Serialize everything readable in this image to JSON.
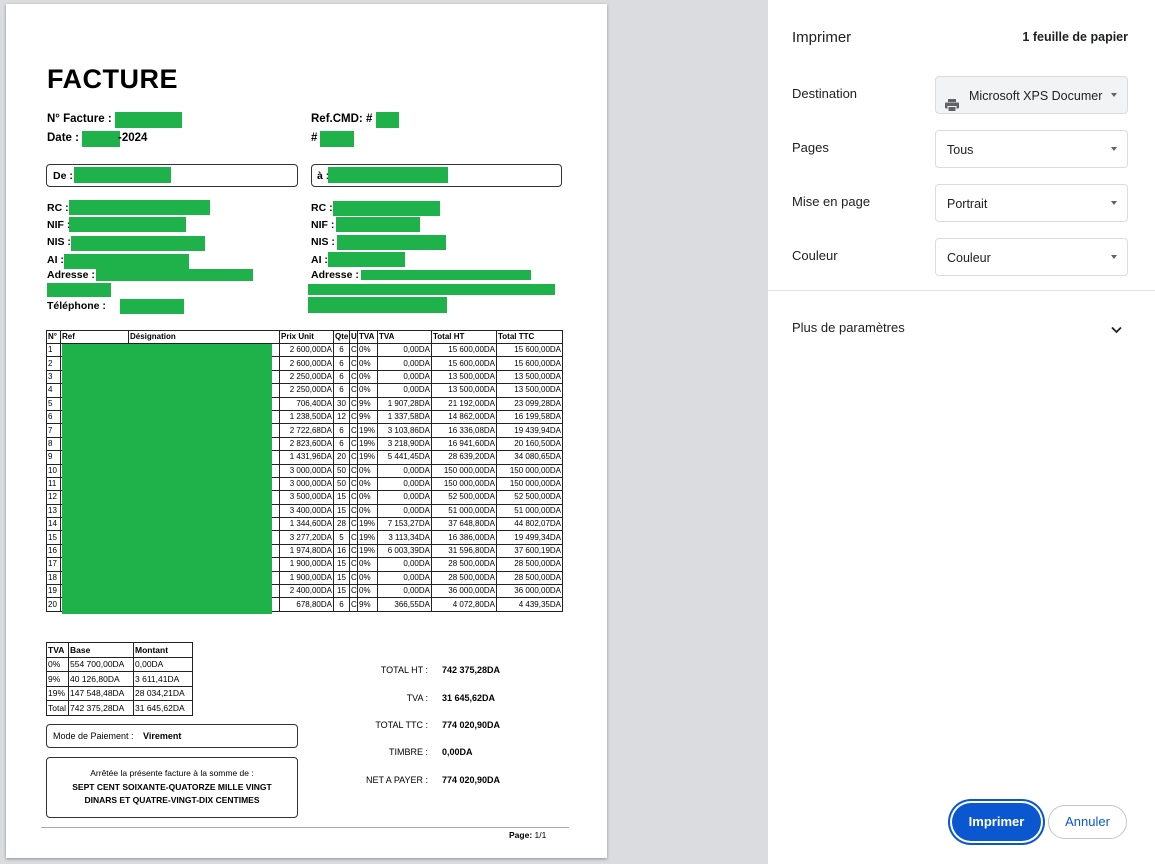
{
  "invoice": {
    "title": "FACTURE",
    "num_label": "N° Facture :",
    "date_label": "Date :",
    "date_year": "-2024",
    "refcmd_label": "Ref.CMD: #",
    "hash": "#",
    "from_label": "De :",
    "to_label": "à :",
    "rc": "RC :",
    "nif": "NIF :",
    "nis": "NIS :",
    "ai": "AI :",
    "adresse": "Adresse :",
    "telephone": "Téléphone :",
    "columns": [
      "N°",
      "Ref",
      "Désignation",
      "Prix Unit",
      "Qte",
      "U",
      "TVA",
      "TVA",
      "Total HT",
      "Total TTC"
    ],
    "rows": [
      [
        "1",
        "2 600,00DA",
        "6",
        "C",
        "0%",
        "0,00DA",
        "15 600,00DA",
        "15 600,00DA"
      ],
      [
        "2",
        "2 600,00DA",
        "6",
        "C",
        "0%",
        "0,00DA",
        "15 600,00DA",
        "15 600,00DA"
      ],
      [
        "3",
        "2 250,00DA",
        "6",
        "C",
        "0%",
        "0,00DA",
        "13 500,00DA",
        "13 500,00DA"
      ],
      [
        "4",
        "2 250,00DA",
        "6",
        "C",
        "0%",
        "0,00DA",
        "13 500,00DA",
        "13 500,00DA"
      ],
      [
        "5",
        "706,40DA",
        "30",
        "C",
        "9%",
        "1 907,28DA",
        "21 192,00DA",
        "23 099,28DA"
      ],
      [
        "6",
        "1 238,50DA",
        "12",
        "C",
        "9%",
        "1 337,58DA",
        "14 862,00DA",
        "16 199,58DA"
      ],
      [
        "7",
        "2 722,68DA",
        "6",
        "C",
        "19%",
        "3 103,86DA",
        "16 336,08DA",
        "19 439,94DA"
      ],
      [
        "8",
        "2 823,60DA",
        "6",
        "C",
        "19%",
        "3 218,90DA",
        "16 941,60DA",
        "20 160,50DA"
      ],
      [
        "9",
        "1 431,96DA",
        "20",
        "C",
        "19%",
        "5 441,45DA",
        "28 639,20DA",
        "34 080,65DA"
      ],
      [
        "10",
        "3 000,00DA",
        "50",
        "C",
        "0%",
        "0,00DA",
        "150 000,00DA",
        "150 000,00DA"
      ],
      [
        "11",
        "3 000,00DA",
        "50",
        "C",
        "0%",
        "0,00DA",
        "150 000,00DA",
        "150 000,00DA"
      ],
      [
        "12",
        "3 500,00DA",
        "15",
        "C",
        "0%",
        "0,00DA",
        "52 500,00DA",
        "52 500,00DA"
      ],
      [
        "13",
        "3 400,00DA",
        "15",
        "C",
        "0%",
        "0,00DA",
        "51 000,00DA",
        "51 000,00DA"
      ],
      [
        "14",
        "1 344,60DA",
        "28",
        "C",
        "19%",
        "7 153,27DA",
        "37 648,80DA",
        "44 802,07DA"
      ],
      [
        "15",
        "3 277,20DA",
        "5",
        "C",
        "19%",
        "3 113,34DA",
        "16 386,00DA",
        "19 499,34DA"
      ],
      [
        "16",
        "1 974,80DA",
        "16",
        "C",
        "19%",
        "6 003,39DA",
        "31 596,80DA",
        "37 600,19DA"
      ],
      [
        "17",
        "1 900,00DA",
        "15",
        "C",
        "0%",
        "0,00DA",
        "28 500,00DA",
        "28 500,00DA"
      ],
      [
        "18",
        "1 900,00DA",
        "15",
        "C",
        "0%",
        "0,00DA",
        "28 500,00DA",
        "28 500,00DA"
      ],
      [
        "19",
        "2 400,00DA",
        "15",
        "C",
        "0%",
        "0,00DA",
        "36 000,00DA",
        "36 000,00DA"
      ],
      [
        "20",
        "678,80DA",
        "6",
        "C",
        "9%",
        "366,55DA",
        "4 072,80DA",
        "4 439,35DA"
      ]
    ],
    "tva_table": {
      "headers": [
        "TVA",
        "Base",
        "Montant"
      ],
      "rows": [
        [
          "0%",
          "554 700,00DA",
          "0,00DA"
        ],
        [
          "9%",
          "40 126,80DA",
          "3 611,41DA"
        ],
        [
          "19%",
          "147 548,48DA",
          "28 034,21DA"
        ],
        [
          "Total",
          "742 375,28DA",
          "31 645,62DA"
        ]
      ]
    },
    "payment_label": "Mode de Paiement :",
    "payment_value": "Virement",
    "arrete_line1": "Arrêtée la présente facture à la somme de :",
    "arrete_line2": "SEPT CENT SOIXANTE-QUATORZE MILLE VINGT",
    "arrete_line3": "DINARS ET QUATRE-VINGT-DIX CENTIMES",
    "totals": [
      {
        "label": "TOTAL HT :",
        "value": "742 375,28DA"
      },
      {
        "label": "TVA :",
        "value": "31 645,62DA"
      },
      {
        "label": "TOTAL TTC :",
        "value": "774 020,90DA"
      },
      {
        "label": "TIMBRE :",
        "value": "0,00DA"
      },
      {
        "label": "NET A PAYER :",
        "value": "774 020,90DA"
      }
    ],
    "page_label": "Page:",
    "page_value": "1/1"
  },
  "print_panel": {
    "title": "Imprimer",
    "sheets": "1 feuille de papier",
    "destination_label": "Destination",
    "destination_value": "Microsoft XPS Documer",
    "pages_label": "Pages",
    "pages_value": "Tous",
    "layout_label": "Mise en page",
    "layout_value": "Portrait",
    "color_label": "Couleur",
    "color_value": "Couleur",
    "more_settings": "Plus de paramètres",
    "print_button": "Imprimer",
    "cancel_button": "Annuler",
    "accent_color": "#0b57d0",
    "icons": [
      "printer-icon",
      "chevron-down-icon"
    ]
  }
}
